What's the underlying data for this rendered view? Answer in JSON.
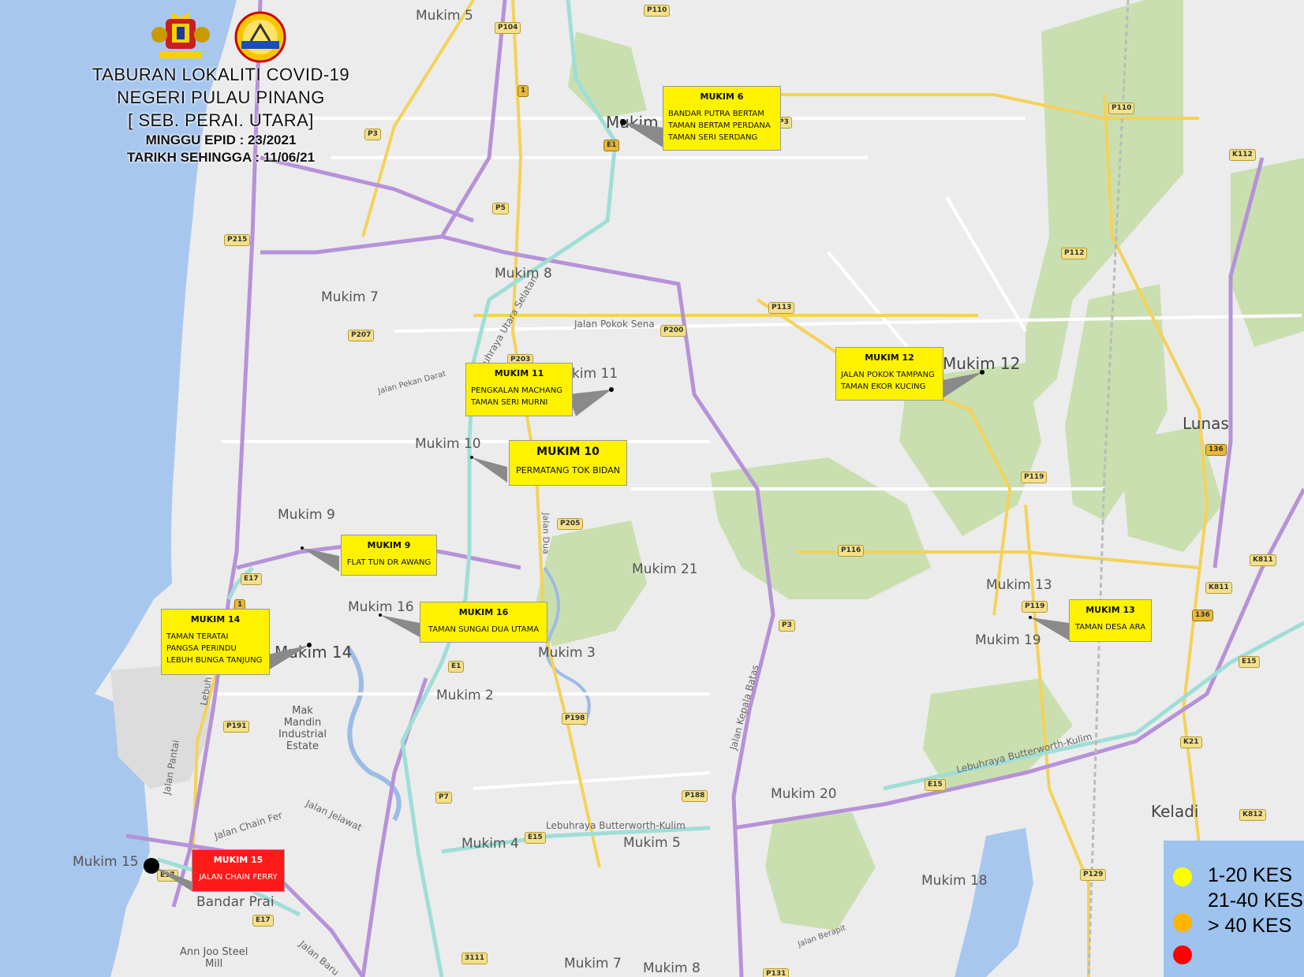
{
  "title": {
    "line1": "TABURAN LOKALITI COVID-19",
    "line2": "NEGERI PULAU PINANG",
    "line3": "[ SEB. PERAI. UTARA]",
    "line4": "MINGGU EPID : 23/2021",
    "line5": "TARIKH SEHINGGA : 11/06/21"
  },
  "places": {
    "mukim5_top": "Mukim 5",
    "mukim6": "Mukim",
    "mukim8": "Mukim 8",
    "mukim7": "Mukim 7",
    "mukim11": "kim 11",
    "mukim10": "Mukim 10",
    "mukim12": "Mukim 12",
    "lunas": "Lunas",
    "mukim9": "Mukim 9",
    "mukim21": "Mukim 21",
    "mukim13": "Mukim 13",
    "mukim19": "Mukim 19",
    "mukim16": "Mukim 16",
    "mukim14": "Mukim 14",
    "mukim3": "Mukim 3",
    "mukim2": "Mukim 2",
    "mak_mandin": "Mak\nMandin\nIndustrial\nEstate",
    "mukim20": "Mukim 20",
    "keladi": "Keladi",
    "mukim4": "Mukim 4",
    "mukim5_bottom": "Mukim 5",
    "mukim18": "Mukim 18",
    "mukim15": "Mukim 15",
    "bandar_prai": "Bandar Prai",
    "ann_joo": "Ann Joo Steel\nMill",
    "mukim7_bottom": "Mukim 7",
    "mukim8_bottom": "Mukim 8"
  },
  "streets": {
    "jalan_pokok_sena": "Jalan Pokok Sena",
    "jalan_pekan_darat": "Jalan Pekan Darat",
    "lebuhraya_utara_selatan": "Lebuhraya Utara Selatan",
    "lebuhraya_bk_1": "Lebuhraya Butterworth-Kulim",
    "lebuhraya_bk_2": "Lebuhraya Butterworth-Kulim",
    "jalan_kepala_batas": "Jalan Kepala Batas",
    "jalan_pantai": "Jalan Pantai",
    "lebuh_raya": "Lebuh Ra",
    "jalan_chain_ferry": "Jalan Chain Fer",
    "jalan_jelawat": "Jalan Jelawat",
    "jalan_baru": "Jalan Baru",
    "jalan_dua": "Jalan Dua",
    "jalan_berapit": "Jalan Berapit"
  },
  "shields": [
    "P110",
    "P104",
    "P3",
    "P3",
    "1",
    "E1",
    "P5",
    "P215",
    "P207",
    "P203",
    "P200",
    "P113",
    "P112",
    "P110",
    "K112",
    "136",
    "P119",
    "P205",
    "P116",
    "P3",
    "E17",
    "1",
    "P119",
    "136",
    "K811",
    "K811",
    "E15",
    "E1",
    "P198",
    "P191",
    "P7",
    "P188",
    "E15",
    "E15",
    "K21",
    "K812",
    "E17",
    "E17",
    "P129",
    "3111",
    "P131"
  ],
  "callouts": [
    {
      "id": "mukim6",
      "title": "MUKIM 6",
      "lines": [
        "BANDAR PUTRA BERTAM",
        "TAMAN BERTAM PERDANA",
        "TAMAN SERI SERDANG"
      ],
      "color": "#fff200"
    },
    {
      "id": "mukim11",
      "title": "MUKIM 11",
      "lines": [
        "PENGKALAN MACHANG",
        "TAMAN SERI MURNI"
      ],
      "color": "#fff200"
    },
    {
      "id": "mukim10",
      "title": "MUKIM 10",
      "lines": [
        "PERMATANG TOK BIDAN"
      ],
      "color": "#fff200"
    },
    {
      "id": "mukim12",
      "title": "MUKIM 12",
      "lines": [
        "JALAN POKOK TAMPANG",
        "TAMAN EKOR KUCING"
      ],
      "color": "#fff200"
    },
    {
      "id": "mukim9",
      "title": "MUKIM 9",
      "lines": [
        "FLAT TUN DR AWANG"
      ],
      "color": "#fff200"
    },
    {
      "id": "mukim14",
      "title": "MUKIM 14",
      "lines": [
        "TAMAN TERATAI",
        "PANGSA PERINDU",
        "LEBUH BUNGA TANJUNG"
      ],
      "color": "#fff200"
    },
    {
      "id": "mukim16",
      "title": "MUKIM 16",
      "lines": [
        "TAMAN SUNGAI DUA UTAMA"
      ],
      "color": "#fff200"
    },
    {
      "id": "mukim13",
      "title": "MUKIM 13",
      "lines": [
        "TAMAN DESA ARA"
      ],
      "color": "#fff200"
    },
    {
      "id": "mukim15",
      "title": "MUKIM 15",
      "lines": [
        "JALAN CHAIN FERRY"
      ],
      "color": "#ff1a1a"
    }
  ],
  "legend": [
    {
      "label": "1-20 KES",
      "color": "#ffff00"
    },
    {
      "label": "21-40 KES",
      "color": "#ffb400"
    },
    {
      "label": "> 40 KES",
      "color": "#ff0000"
    }
  ]
}
